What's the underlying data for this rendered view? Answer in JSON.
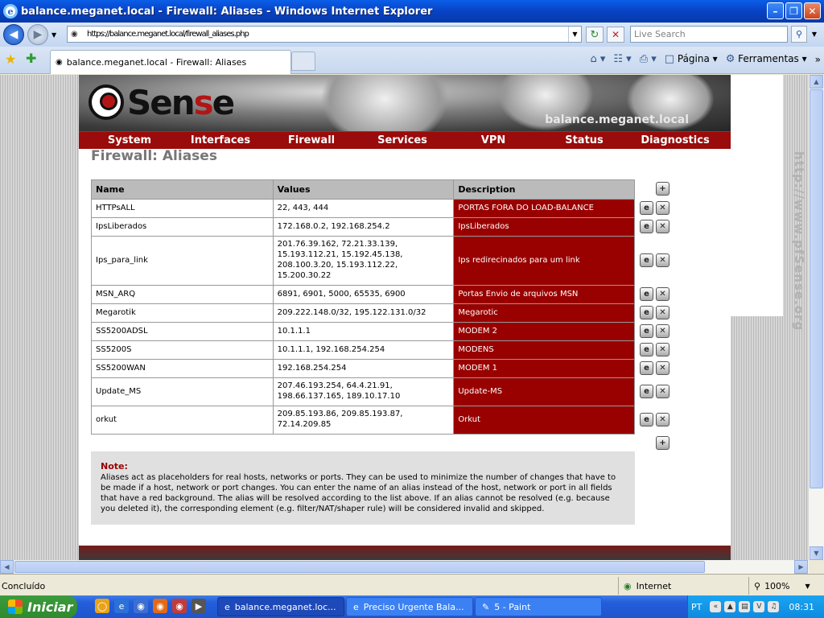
{
  "window": {
    "title": "balance.meganet.local - Firewall: Aliases - Windows Internet Explorer"
  },
  "toolbar": {
    "address": "https://balance.meganet.local/firewall_aliases.php",
    "search_placeholder": "Live Search"
  },
  "tabs": {
    "active_label": "balance.meganet.local - Firewall: Aliases"
  },
  "commands": {
    "page_label": "Página",
    "tools_label": "Ferramentas"
  },
  "site": {
    "logo_text_prefix": "Sen",
    "logo_text_s": "s",
    "logo_text_e": "e",
    "hostname": "balance.meganet.local",
    "vertical_url": "http://www.pfSense.org",
    "menu": [
      "System",
      "Interfaces",
      "Firewall",
      "Services",
      "VPN",
      "Status",
      "Diagnostics"
    ],
    "page_title": "Firewall: Aliases"
  },
  "table": {
    "headers": [
      "Name",
      "Values",
      "Description"
    ],
    "rows": [
      {
        "name": "HTTPsALL",
        "values": "22, 443, 444",
        "description": "PORTAS FORA DO LOAD-BALANCE"
      },
      {
        "name": "IpsLiberados",
        "values": "172.168.0.2, 192.168.254.2",
        "description": "IpsLiberados"
      },
      {
        "name": "Ips_para_link",
        "values": "201.76.39.162, 72.21.33.139, 15.193.112.21, 15.192.45.138, 208.100.3.20, 15.193.112.22, 15.200.30.22",
        "description": "Ips redirecinados para um link"
      },
      {
        "name": "MSN_ARQ",
        "values": "6891, 6901, 5000, 65535, 6900",
        "description": "Portas Envio de arquivos MSN"
      },
      {
        "name": "Megarotik",
        "values": "209.222.148.0/32, 195.122.131.0/32",
        "description": "Megarotic"
      },
      {
        "name": "SS5200ADSL",
        "values": "10.1.1.1",
        "description": "MODEM 2"
      },
      {
        "name": "SS5200S",
        "values": "10.1.1.1, 192.168.254.254",
        "description": "MODENS"
      },
      {
        "name": "SS5200WAN",
        "values": "192.168.254.254",
        "description": "MODEM 1"
      },
      {
        "name": "Update_MS",
        "values": "207.46.193.254, 64.4.21.91, 198.66.137.165, 189.10.17.10",
        "description": "Update-MS"
      },
      {
        "name": "orkut",
        "values": "209.85.193.86, 209.85.193.87, 72.14.209.85",
        "description": "Orkut"
      }
    ]
  },
  "note": {
    "title": "Note:",
    "body": "Aliases act as placeholders for real hosts, networks or ports. They can be used to minimize the number of changes that have to be made if a host, network or port changes. You can enter the name of an alias instead of the host, network or port in all fields that have a red background. The alias will be resolved according to the list above. If an alias cannot be resolved (e.g. because you deleted it), the corresponding element (e.g. filter/NAT/shaper rule) will be considered invalid and skipped."
  },
  "status": {
    "text": "Concluído",
    "zone": "Internet",
    "zoom": "100%"
  },
  "taskbar": {
    "start_label": "Iniciar",
    "tasks": [
      "balance.meganet.loc...",
      "Preciso Urgente Bala...",
      "5 - Paint"
    ],
    "lang": "PT",
    "clock": "08:31"
  },
  "colors": {
    "accent_red": "#990000",
    "menu_red": "#9a0b0b",
    "xp_blue": "#245edb"
  }
}
